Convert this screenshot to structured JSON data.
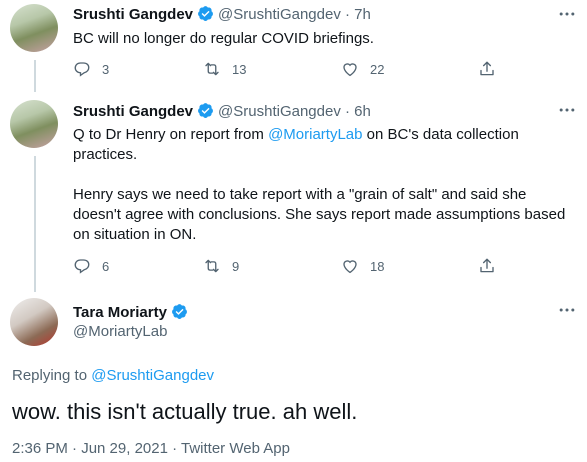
{
  "tweets": [
    {
      "name": "Srushti Gangdev",
      "handle": "@SrushtiGangdev",
      "time": " · 7h",
      "text": "BC will no longer do regular COVID briefings.",
      "replies": "3",
      "retweets": "13",
      "likes": "22"
    },
    {
      "name": "Srushti Gangdev",
      "handle": "@SrushtiGangdev",
      "time": " · 6h",
      "text_pre": "Q to Dr Henry on report from ",
      "mention": "@MoriartyLab",
      "text_post": " on BC's data collection practices.\n\nHenry says we need to take report with a \"grain of salt\" and said she doesn't agree with conclusions. She says report made assumptions based on situation in ON.",
      "replies": "6",
      "retweets": "9",
      "likes": "18"
    }
  ],
  "main_tweet": {
    "name": "Tara Moriarty",
    "handle": "@MoriartyLab",
    "replying_to_label": "Replying to ",
    "replying_to_handle": "@SrushtiGangdev",
    "text": "wow. this isn't actually true. ah well.",
    "timestamp": "2:36 PM · Jun 29, 2021 · ",
    "source": "Twitter Web App"
  },
  "colors": {
    "accent": "#1d9bf0",
    "secondary_text": "#536471",
    "primary_text": "#0f1419"
  },
  "icons": [
    "verified-icon",
    "reply-icon",
    "retweet-icon",
    "like-icon",
    "share-icon",
    "more-icon"
  ]
}
